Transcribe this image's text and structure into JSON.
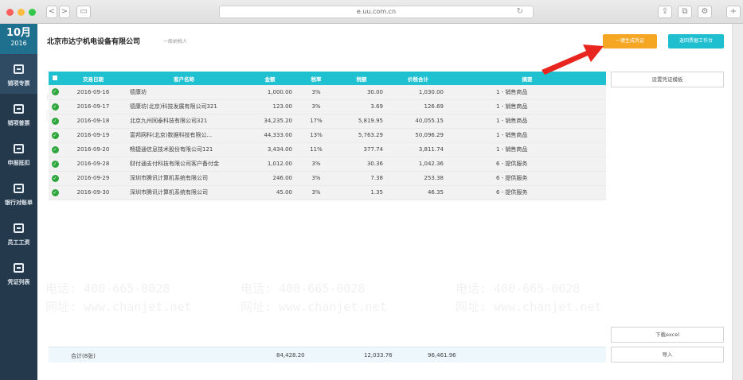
{
  "browser": {
    "url": "e.uu.com.cn",
    "nav_back_label": "<",
    "nav_forward_label": ">",
    "sidebar_toggle_label": "▭",
    "reload_label": "↻",
    "share_label": "⇪",
    "tabs_label": "⧉",
    "extension_label": "⚙",
    "new_tab_label": "+"
  },
  "sidebar": {
    "month": "10月",
    "year": "2016",
    "items": [
      {
        "label": "销项专票",
        "icon": "invoice-icon",
        "active": true
      },
      {
        "label": "销项普票",
        "icon": "invoice-icon",
        "active": false
      },
      {
        "label": "申报抵扣",
        "icon": "document-icon",
        "active": false
      },
      {
        "label": "银行对账单",
        "icon": "clipboard-icon",
        "active": false
      },
      {
        "label": "员工工资",
        "icon": "wallet-icon",
        "active": false
      },
      {
        "label": "凭证列表",
        "icon": "list-icon",
        "active": false
      }
    ]
  },
  "header": {
    "company": "北京市达宁机电设备有限公司",
    "taxpayer_type": "一般纳税人",
    "generate_button": "一键生成凭证",
    "return_button": "返回票据工作台"
  },
  "table": {
    "columns": [
      "",
      "交易日期",
      "客户名称",
      "金额",
      "税率",
      "税额",
      "价税合计",
      "摘要"
    ],
    "rows": [
      {
        "date": "2016-09-16",
        "customer": "德康坊",
        "amount": "1,000.00",
        "rate": "3%",
        "tax": "30.00",
        "total": "1,030.00",
        "summary": "1 - 销售商品"
      },
      {
        "date": "2016-09-17",
        "customer": "德康坊(北京)科技发展有限公司321",
        "amount": "123.00",
        "rate": "3%",
        "tax": "3.69",
        "total": "126.69",
        "summary": "1 - 销售商品"
      },
      {
        "date": "2016-09-18",
        "customer": "北京九州同泰科技有限公司321",
        "amount": "34,235.20",
        "rate": "17%",
        "tax": "5,819.95",
        "total": "40,055.15",
        "summary": "1 - 销售商品"
      },
      {
        "date": "2016-09-19",
        "customer": "富邦网科(北京)数据科技有限公...",
        "amount": "44,333.00",
        "rate": "13%",
        "tax": "5,763.29",
        "total": "50,096.29",
        "summary": "1 - 销售商品"
      },
      {
        "date": "2016-09-20",
        "customer": "畅捷通信息技术股份有限公司121",
        "amount": "3,434.00",
        "rate": "11%",
        "tax": "377.74",
        "total": "3,811.74",
        "summary": "1 - 销售商品"
      },
      {
        "date": "2016-09-28",
        "customer": "财付通支付科技有限公司客户备付金",
        "amount": "1,012.00",
        "rate": "3%",
        "tax": "30.36",
        "total": "1,042.36",
        "summary": "6 - 提供服务"
      },
      {
        "date": "2016-09-29",
        "customer": "深圳市腾讯计算机系统有限公司",
        "amount": "246.00",
        "rate": "3%",
        "tax": "7.38",
        "total": "253.38",
        "summary": "6 - 提供服务"
      },
      {
        "date": "2016-09-30",
        "customer": "深圳市腾讯计算机系统有限公司",
        "amount": "45.00",
        "rate": "3%",
        "tax": "1.35",
        "total": "46.35",
        "summary": "6 - 提供服务"
      }
    ],
    "check_mark": "✓"
  },
  "footer": {
    "label": "合计(8张)",
    "amount": "84,428.20",
    "tax": "12,033.76",
    "total": "96,461.96"
  },
  "side_buttons": {
    "template": "设置凭证模板",
    "download": "下载excel",
    "import": "导入"
  },
  "watermark": {
    "phone": "电话: 400-665-0028",
    "site": "网址: www.chanjet.net"
  },
  "colors": {
    "accent_teal": "#1fc0d0",
    "accent_orange": "#f5a623",
    "sidebar_bg": "#25394d",
    "check_green": "#2da73c",
    "arrow_red": "#e8261f"
  }
}
